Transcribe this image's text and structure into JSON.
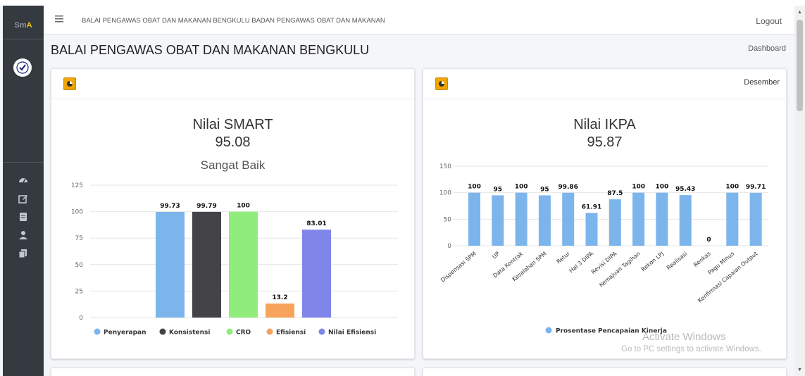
{
  "app": {
    "logo_text_1": "Sm",
    "logo_text_2": "A",
    "header_title": "BALAI PENGAWAS OBAT DAN MAKANAN BENGKULU BADAN PENGAWAS OBAT DAN MAKANAN",
    "logout_label": "Logout"
  },
  "sidebar": {
    "icons": [
      "dashboard-icon",
      "edit-icon",
      "book-icon",
      "user-icon",
      "copy-icon"
    ]
  },
  "page": {
    "title": "BALAI PENGAWAS OBAT DAN MAKANAN BENGKULU",
    "breadcrumb": "Dashboard"
  },
  "smart_card": {
    "title": "Nilai SMART",
    "value": "95.08",
    "rating": "Sangat Baik"
  },
  "ikpa_card": {
    "month": "Desember",
    "title": "Nilai IKPA",
    "value": "95.87"
  },
  "watermark": {
    "line1": "Activate Windows",
    "line2": "Go to PC settings to activate Windows."
  },
  "chart_data": [
    {
      "type": "bar",
      "title": "Nilai SMART",
      "subtitle": "Sangat Baik",
      "categories": [
        "Penyerapan",
        "Konsistensi",
        "CRO",
        "Efisiensi",
        "Nilai Efisiensi"
      ],
      "values": [
        99.73,
        99.79,
        100,
        13.2,
        83.01
      ],
      "value_labels": [
        "99.73",
        "99.79",
        "100",
        "13.2",
        "83.01"
      ],
      "colors": [
        "#7cb5ec",
        "#434348",
        "#90ed7d",
        "#f7a35c",
        "#8085e9"
      ],
      "ylim": [
        0,
        125
      ],
      "yticks": [
        "0",
        "25",
        "50",
        "75",
        "100",
        "125"
      ],
      "grid": true,
      "legend": "bottom"
    },
    {
      "type": "bar",
      "title": "Nilai IKPA",
      "categories": [
        "Dispensasi SPM",
        "UP",
        "Data Kontrak",
        "Kesalahan SPM",
        "Retur",
        "Hal 3 DIPA",
        "Revisi DIPA",
        "Kemajuan Tagihan",
        "Rekon LPJ",
        "Realisasi",
        "Renkas",
        "Pagu Minus",
        "Konfirmasi Capaian Output"
      ],
      "series": [
        {
          "name": "Prosentase Pencapaian Kinerja",
          "values": [
            100,
            95,
            100,
            95,
            99.86,
            61.91,
            87.5,
            100,
            100,
            95.43,
            0,
            100,
            99.71
          ],
          "value_labels": [
            "100",
            "95",
            "100",
            "95",
            "99.86",
            "61.91",
            "87.5",
            "100",
            "100",
            "95.43",
            "0",
            "100",
            "99.71"
          ]
        }
      ],
      "color": "#7cb5ec",
      "ylim": [
        0,
        150
      ],
      "yticks": [
        "0",
        "50",
        "100",
        "150"
      ],
      "grid": true,
      "legend": "bottom"
    }
  ]
}
